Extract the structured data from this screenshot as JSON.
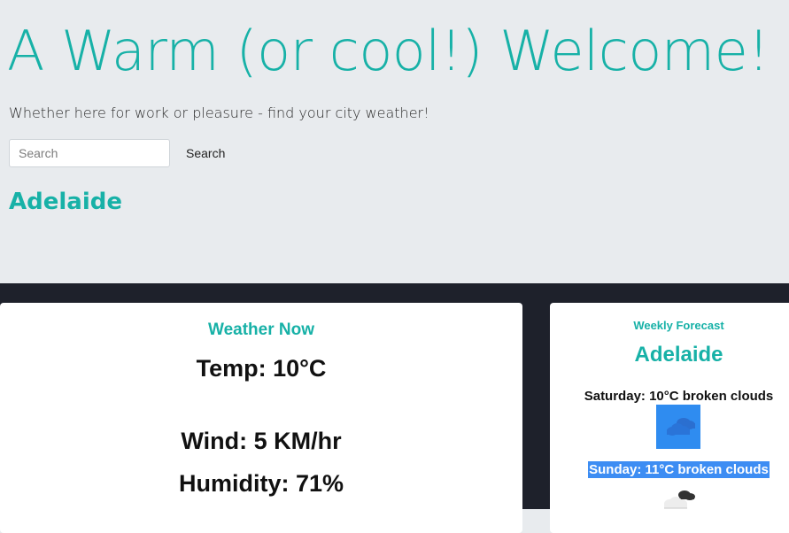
{
  "hero": {
    "title": "A Warm (or cool!) Welcome!",
    "subtitle": "Whether here for work or pleasure - find your city weather!"
  },
  "search": {
    "placeholder": "Search",
    "button_label": "Search"
  },
  "city": "Adelaide",
  "weather_now": {
    "title": "Weather Now",
    "temp": "Temp: 10°C",
    "wind": "Wind: 5 KM/hr",
    "humidity": "Humidity: 71%"
  },
  "weekly": {
    "label": "Weekly Forecast",
    "city": "Adelaide",
    "days": [
      {
        "text": "Saturday: 10°C broken clouds",
        "icon": "broken-clouds-icon"
      },
      {
        "text": "Sunday: 11°C broken clouds",
        "icon": "broken-clouds-icon"
      }
    ]
  },
  "colors": {
    "accent": "#17b1a7",
    "hero_bg": "#e8ebee",
    "dark_band": "#1e212b",
    "selection": "#3d8df3"
  }
}
